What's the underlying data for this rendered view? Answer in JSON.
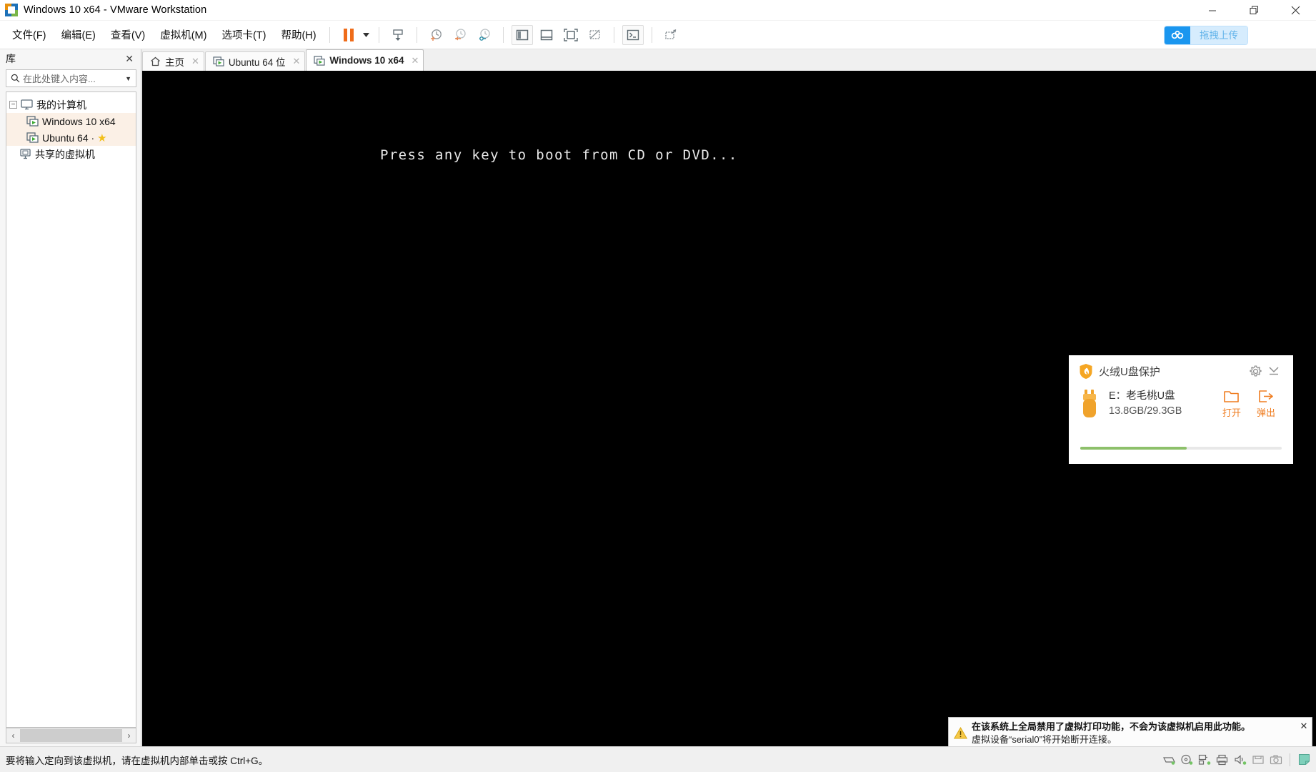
{
  "window": {
    "title": "Windows 10 x64 - VMware Workstation",
    "app_icon": "vmware-logo-icon",
    "controls": [
      {
        "name": "minimize-button",
        "glyph": "minimize-icon"
      },
      {
        "name": "restore-button",
        "glyph": "restore-icon"
      },
      {
        "name": "close-button",
        "glyph": "close-icon"
      }
    ]
  },
  "menu": {
    "items": [
      {
        "label": "文件(F)",
        "name": "menu-file"
      },
      {
        "label": "编辑(E)",
        "name": "menu-edit"
      },
      {
        "label": "查看(V)",
        "name": "menu-view"
      },
      {
        "label": "虚拟机(M)",
        "name": "menu-vm"
      },
      {
        "label": "选项卡(T)",
        "name": "menu-tabs"
      },
      {
        "label": "帮助(H)",
        "name": "menu-help"
      }
    ]
  },
  "toolbar": {
    "buttons": [
      {
        "name": "pause-vm-button",
        "icon": "pause-icon"
      },
      {
        "name": "power-dropdown-button",
        "icon": "chevron-down-icon"
      },
      {
        "name": "snapshot-manager-button",
        "icon": "snapshot-icon"
      },
      {
        "name": "take-snapshot-button",
        "icon": "clock-plus-icon"
      },
      {
        "name": "revert-snapshot-button",
        "icon": "clock-revert-icon"
      },
      {
        "name": "manage-snapshots-button",
        "icon": "clock-manage-icon"
      },
      {
        "name": "show-library-button",
        "icon": "sidebar-panel-icon"
      },
      {
        "name": "show-thumbnail-bar-button",
        "icon": "bottom-panel-icon"
      },
      {
        "name": "full-screen-button",
        "icon": "fullscreen-icon"
      },
      {
        "name": "unity-mode-button",
        "icon": "unity-icon"
      },
      {
        "name": "console-button",
        "icon": "console-icon"
      },
      {
        "name": "stretch-guest-button",
        "icon": "stretch-icon"
      }
    ],
    "upload": {
      "label": "拖拽上传",
      "icon": "cloud-upload-icon",
      "icon_bg": "#1a96ef",
      "label_bg": "#d6ecfd",
      "label_color": "#63b4ea"
    }
  },
  "sidebar": {
    "title": "库",
    "close_label": "✕",
    "search": {
      "placeholder": "在此处键入内容...",
      "icon": "search-icon",
      "caret": "▼"
    },
    "tree": [
      {
        "label": "我的计算机",
        "name": "tree-item-my-computer",
        "level": 0,
        "icon": "monitor-icon",
        "expander": "−",
        "selected": false,
        "favorite": false
      },
      {
        "label": "Windows 10 x64",
        "name": "tree-item-windows-10-x64",
        "level": 1,
        "icon": "vm-icon",
        "selected": true,
        "favorite": false
      },
      {
        "label": "Ubuntu 64 ·",
        "name": "tree-item-ubuntu-64",
        "level": 1,
        "icon": "vm-icon",
        "selected": true,
        "favorite": true
      },
      {
        "label": "共享的虚拟机",
        "name": "tree-item-shared-vms",
        "level": 0,
        "icon": "shared-vm-icon",
        "selected": false,
        "favorite": false
      }
    ],
    "scroll": {
      "left": "‹",
      "right": "›"
    }
  },
  "tabs": [
    {
      "label": "主页",
      "name": "tab-home",
      "icon": "home-icon",
      "active": false,
      "closable": true
    },
    {
      "label": "Ubuntu 64 位",
      "name": "tab-ubuntu-64",
      "icon": "vm-icon",
      "active": false,
      "closable": true
    },
    {
      "label": "Windows 10 x64",
      "name": "tab-windows-10-x64",
      "icon": "vm-icon",
      "active": true,
      "closable": true
    }
  ],
  "vm_screen": {
    "background": "#000000",
    "boot_message": "Press any key to boot from CD or DVD..."
  },
  "usb_popup": {
    "title": "火绒U盘保护",
    "shield_icon": "shield-flame-icon",
    "settings_icon": "gear-icon",
    "collapse_icon": "chevron-down-icon",
    "drive": {
      "name": "E：老毛桃U盘",
      "capacity": "13.8GB/29.3GB",
      "usb_icon": "usb-stick-icon",
      "used_percent": 53,
      "bar_color": "#8dc06a"
    },
    "actions": [
      {
        "label": "打开",
        "name": "open-drive-button",
        "icon": "folder-open-icon"
      },
      {
        "label": "弹出",
        "name": "eject-drive-button",
        "icon": "eject-icon"
      }
    ],
    "accent": "#ef7d21"
  },
  "toast": {
    "icon": "warning-triangle-icon",
    "line1": "在该系统上全局禁用了虚拟打印功能，不会为该虚拟机启用此功能。",
    "line2": "虚拟设备“serial0”将开始断开连接。",
    "close_label": "✕"
  },
  "statusbar": {
    "message": "要将输入定向到该虚拟机，请在虚拟机内部单击或按 Ctrl+G。",
    "devices": [
      {
        "name": "hard-disk-icon"
      },
      {
        "name": "cd-dvd-icon"
      },
      {
        "name": "network-adapter-icon"
      },
      {
        "name": "printer-icon"
      },
      {
        "name": "sound-card-icon"
      },
      {
        "name": "floppy-icon"
      },
      {
        "name": "camera-icon"
      },
      {
        "name": "notes-icon"
      }
    ]
  }
}
